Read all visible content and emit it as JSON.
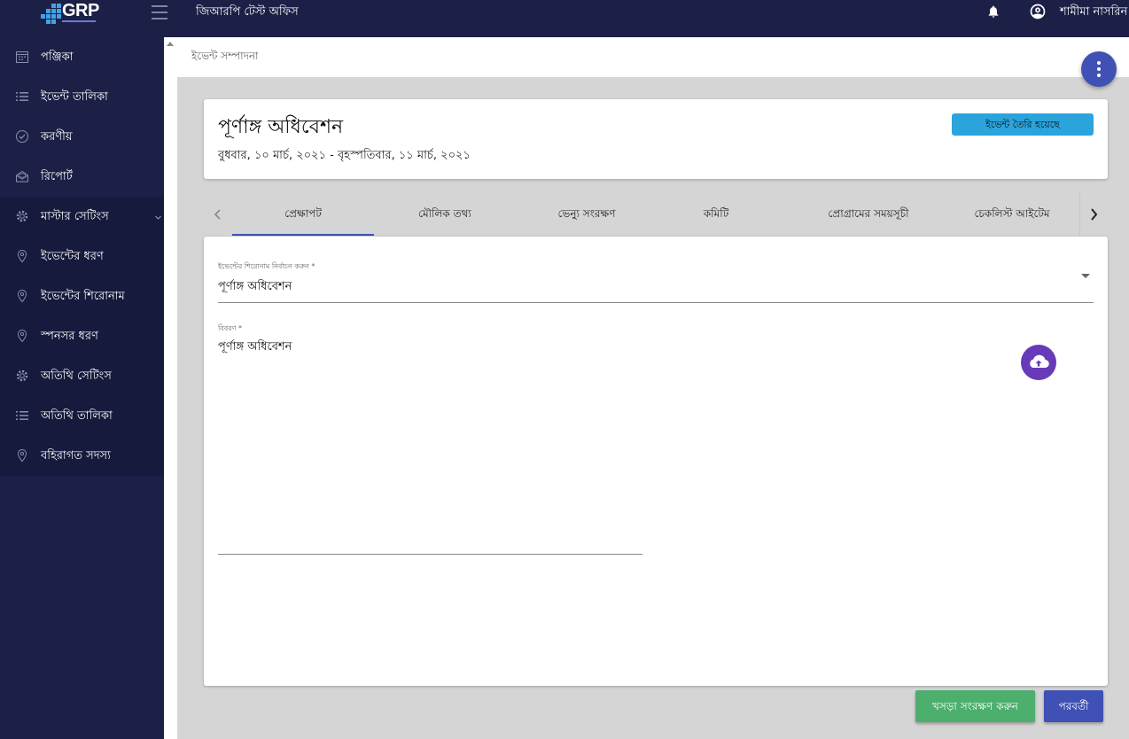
{
  "app": {
    "logo_text": "GRP",
    "office_title": "জিআরপি টেস্ট অফিস",
    "user_name": "শামীমা নাসরিন"
  },
  "sidebar": {
    "items": [
      {
        "label": "পঞ্জিকা",
        "icon": "calendar-icon"
      },
      {
        "label": "ইভেন্ট তালিকা",
        "icon": "list-icon"
      },
      {
        "label": "করণীয়",
        "icon": "check-circle-icon"
      },
      {
        "label": "রিপোর্ট",
        "icon": "report-icon"
      },
      {
        "label": "মাস্টার সেটিংস",
        "icon": "gear-icon",
        "expandable": true
      },
      {
        "label": "ইভেন্টের ধরণ",
        "icon": "location-pin-icon"
      },
      {
        "label": "ইভেন্টের শিরোনাম",
        "icon": "location-pin-icon"
      },
      {
        "label": "স্পনসর ধরণ",
        "icon": "location-pin-icon"
      },
      {
        "label": "অতিথি সেটিংস",
        "icon": "gear-icon"
      },
      {
        "label": "অতিথি তালিকা",
        "icon": "list-icon"
      },
      {
        "label": "বহিরাগত সদস্য",
        "icon": "location-pin-icon"
      }
    ]
  },
  "breadcrumb": "ইভেন্ট সম্পাদনা",
  "event": {
    "title": "পূর্ণাঙ্গ অধিবেশন",
    "date_range": "বুধবার, ১০ মার্চ, ২০২১ - বৃহস্পতিবার, ১১ মার্চ, ২০২১",
    "status": "ইভেন্ট তৈরি হয়েছে"
  },
  "tabs": [
    {
      "label": "প্রেক্ষাপট",
      "active": true
    },
    {
      "label": "মৌলিক তথ্য"
    },
    {
      "label": "ভেন্যু সংরক্ষণ"
    },
    {
      "label": "কমিটি"
    },
    {
      "label": "প্রোগ্রামের সময়সূচী"
    },
    {
      "label": "চেকলিস্ট আইটেম"
    }
  ],
  "form": {
    "title_field": {
      "label": "ইভেন্টের শিরোনাম নির্বাচন করুন *",
      "value": "পূর্ণাঙ্গ অধিবেশন"
    },
    "description_field": {
      "label": "বিবরণ *",
      "value": "পূর্ণাঙ্গ অধিবেশন"
    }
  },
  "buttons": {
    "save_draft": "খসড়া সংরক্ষণ করুন",
    "next": "পরবর্তী"
  },
  "colors": {
    "nav_bg": "#1c2047",
    "primary": "#3f51b5",
    "status_badge": "#2ba4dc",
    "upload": "#673ab7",
    "draft_button": "#4caf6e"
  }
}
